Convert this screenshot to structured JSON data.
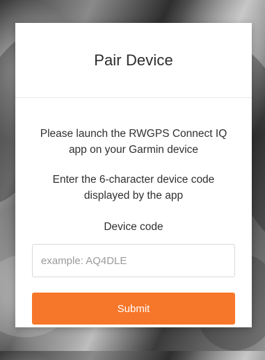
{
  "dialog": {
    "title": "Pair Device",
    "instruction_launch": "Please launch the RWGPS Connect IQ app on your Garmin device",
    "instruction_enter": "Enter the 6-character device code displayed by the app",
    "code_label": "Device code",
    "code_input": {
      "value": "",
      "placeholder": "example: AQ4DLE"
    },
    "submit_label": "Submit"
  },
  "colors": {
    "accent": "#f7772a",
    "panel": "#ffffff",
    "text": "#2f2f2f"
  }
}
